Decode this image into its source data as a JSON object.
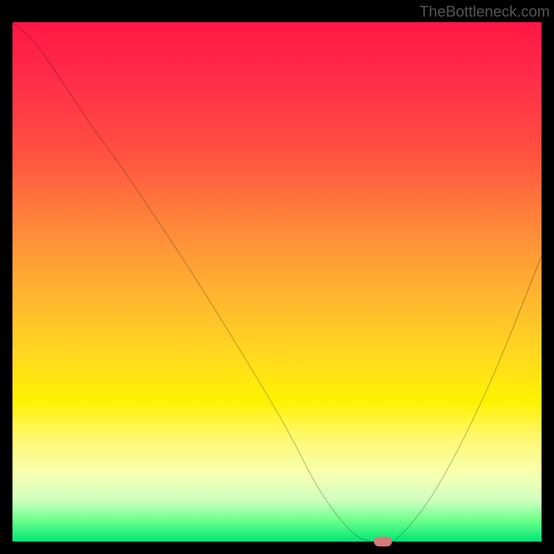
{
  "watermark": "TheBottleneck.com",
  "chart_data": {
    "type": "line",
    "title": "",
    "xlabel": "",
    "ylabel": "",
    "xlim": [
      0,
      100
    ],
    "ylim": [
      0,
      100
    ],
    "x": [
      0,
      5,
      15,
      22,
      35,
      50,
      58,
      64,
      68,
      72,
      80,
      90,
      100
    ],
    "values": [
      100,
      95,
      80,
      70,
      50,
      25,
      10,
      2,
      0,
      0,
      10,
      30,
      55
    ],
    "marker": {
      "x": 70,
      "y": 0
    },
    "gradient_stops": [
      {
        "pos": 0,
        "color": "#ff1744"
      },
      {
        "pos": 25,
        "color": "#ff5040"
      },
      {
        "pos": 50,
        "color": "#ffb330"
      },
      {
        "pos": 73,
        "color": "#fff200"
      },
      {
        "pos": 92,
        "color": "#d0ffc0"
      },
      {
        "pos": 100,
        "color": "#00e676"
      }
    ]
  }
}
